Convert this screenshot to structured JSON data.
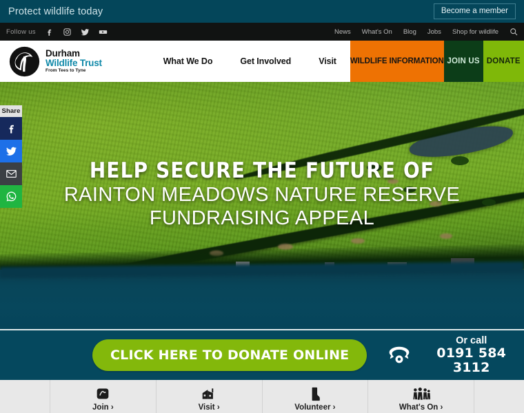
{
  "utility": {
    "tagline": "Protect wildlife today",
    "member_button": "Become a member"
  },
  "social_bar": {
    "follow_label": "Follow us",
    "icons": [
      {
        "name": "facebook-icon"
      },
      {
        "name": "instagram-icon"
      },
      {
        "name": "twitter-icon"
      },
      {
        "name": "youtube-icon"
      }
    ],
    "links": [
      "News",
      "What's On",
      "Blog",
      "Jobs",
      "Shop for wildlife"
    ],
    "search_icon": "search-icon"
  },
  "brand": {
    "line1": "Durham",
    "line2": "Wildlife Trust",
    "line3": "From Tees to Tyne",
    "logo_icon": "badger-logo-icon"
  },
  "nav": {
    "items": [
      "What We Do",
      "Get Involved",
      "Visit"
    ],
    "wildlife_information": "WILDLIFE INFORMATION",
    "join_us": "JOIN US",
    "donate": "DONATE"
  },
  "share": {
    "label": "Share",
    "buttons": [
      {
        "name": "share-facebook",
        "color": "#16295c"
      },
      {
        "name": "share-twitter",
        "color": "#1d70e8"
      },
      {
        "name": "share-email",
        "color": "#3b4044"
      },
      {
        "name": "share-whatsapp",
        "color": "#20b541"
      }
    ]
  },
  "hero": {
    "headline_line1": "HELP SECURE THE FUTURE OF",
    "headline_line2": "RAINTON MEADOWS NATURE RESERVE",
    "headline_line3": "FUNDRAISING APPEAL"
  },
  "cta": {
    "donate_button": "CLICK HERE TO DONATE ONLINE",
    "call_label": "Or call",
    "phone_number": "0191 584 3112",
    "phone_icon": "telephone-icon"
  },
  "tiles": [
    {
      "label": "Join ›",
      "icon": "membership-card-icon"
    },
    {
      "label": "Visit ›",
      "icon": "visitor-centre-icon"
    },
    {
      "label": "Volunteer ›",
      "icon": "wellington-boot-icon"
    },
    {
      "label": "What's On ›",
      "icon": "people-group-icon"
    }
  ],
  "colors": {
    "teal_dark": "#04465a",
    "orange": "#ee7203",
    "green_dark": "#0c3d18",
    "green_light": "#7fb809",
    "donate_green": "#83b80b",
    "brand_blue": "#0e88a8"
  }
}
